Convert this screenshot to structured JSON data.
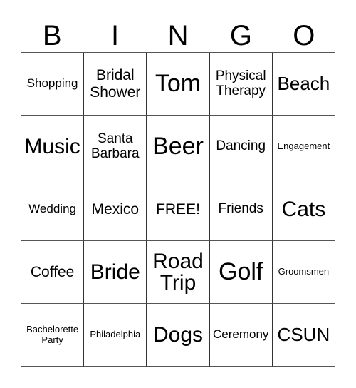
{
  "header": [
    "B",
    "I",
    "N",
    "G",
    "O"
  ],
  "cells": [
    [
      "Shopping",
      "Bridal\nShower",
      "Tom",
      "Physical\nTherapy",
      "Beach"
    ],
    [
      "Music",
      "Santa\nBarbara",
      "Beer",
      "Dancing",
      "Engagement"
    ],
    [
      "Wedding",
      "Mexico",
      "FREE!",
      "Friends",
      "Cats"
    ],
    [
      "Coffee",
      "Bride",
      "Road\nTrip",
      "Golf",
      "Groomsmen"
    ],
    [
      "Bachelorette\nParty",
      "Philadelphia",
      "Dogs",
      "Ceremony",
      "CSUN"
    ]
  ]
}
